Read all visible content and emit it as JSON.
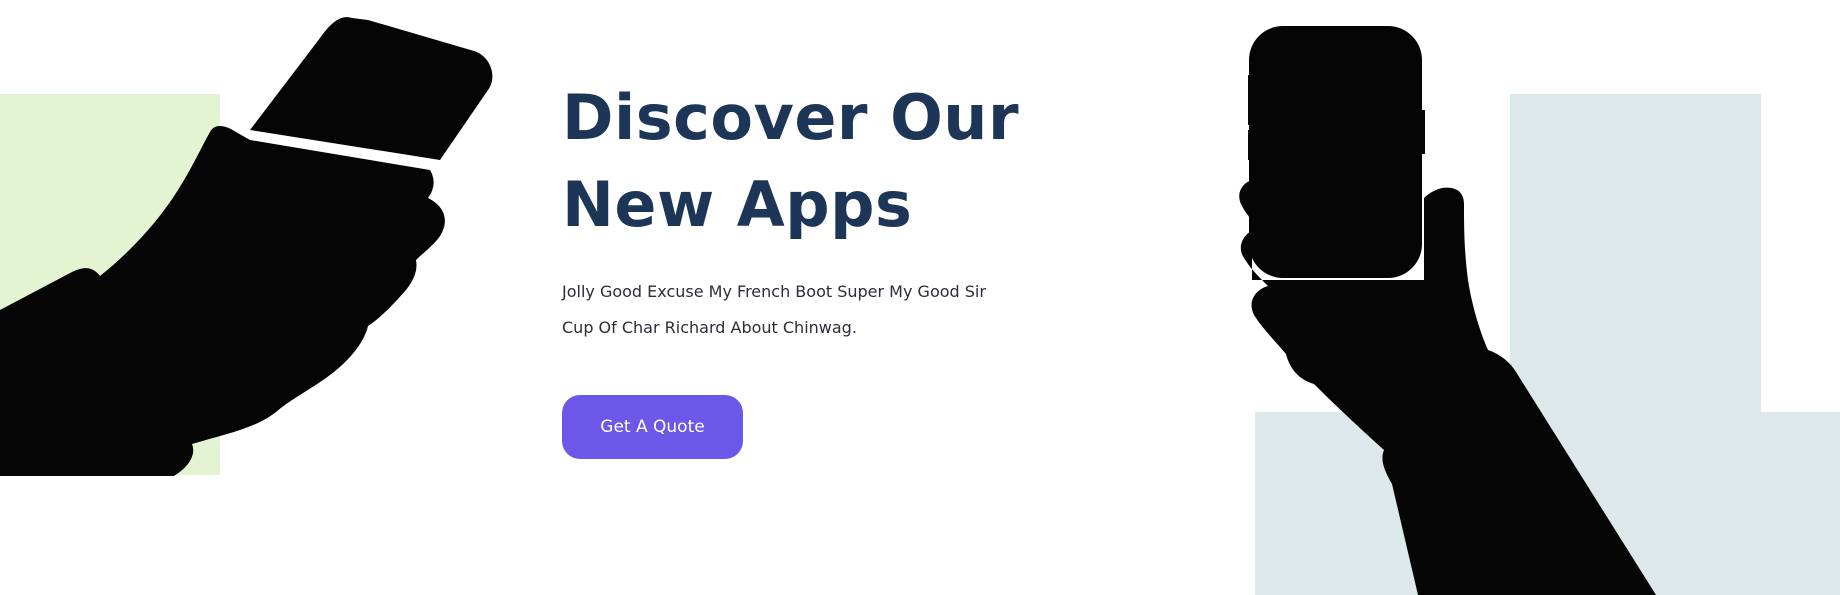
{
  "hero": {
    "title_line1": "Discover Our",
    "title_line2": "New Apps",
    "description": "Jolly Good Excuse My French Boot Super My Good Sir Cup Of Char Richard About Chinwag.",
    "cta_label": "Get A Quote"
  },
  "colors": {
    "green_block": "#e4f4d3",
    "blue_block": "#dde8ea",
    "silhouette": "#050505",
    "cta_bg": "#6b57e8"
  },
  "icons": {
    "left_illustration": "hand-holding-phone-illustration",
    "right_illustration": "hand-holding-phone-illustration"
  }
}
